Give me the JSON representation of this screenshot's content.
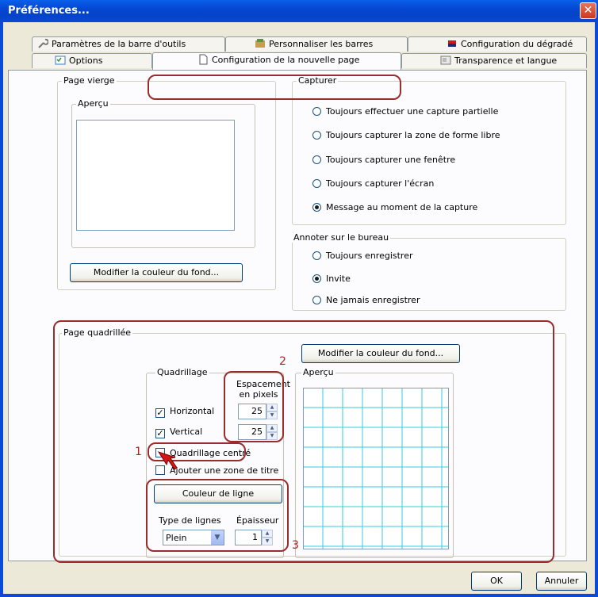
{
  "window": {
    "title": "Préférences..."
  },
  "tabs": {
    "row1": [
      {
        "label": "Paramètres de la barre d'outils",
        "icon": "wrench-icon"
      },
      {
        "label": "Personnaliser les barres",
        "icon": "toolbar-icon"
      },
      {
        "label": "Configuration du dégradé",
        "icon": "gradient-icon"
      }
    ],
    "row2": [
      {
        "label": "Options",
        "icon": "options-icon"
      },
      {
        "label": "Configuration de la nouvelle page",
        "icon": "page-icon",
        "active": true
      },
      {
        "label": "Transparence et langue",
        "icon": "transparency-icon"
      }
    ]
  },
  "blank_page": {
    "title": "Page vierge",
    "preview_title": "Aperçu",
    "bg_button": "Modifier la couleur du fond..."
  },
  "capture": {
    "title": "Capturer",
    "options": [
      {
        "label": "Toujours effectuer une capture partielle",
        "selected": false
      },
      {
        "label": "Toujours capturer la zone de forme libre",
        "selected": false
      },
      {
        "label": "Toujours capturer une fenêtre",
        "selected": false
      },
      {
        "label": "Toujours capturer l'écran",
        "selected": false
      },
      {
        "label": "Message au moment de la capture",
        "selected": true
      }
    ]
  },
  "desktop": {
    "title": "Annoter sur le bureau",
    "options": [
      {
        "label": "Toujours enregistrer",
        "selected": false
      },
      {
        "label": "Invite",
        "selected": true
      },
      {
        "label": "Ne jamais enregistrer",
        "selected": false
      }
    ]
  },
  "grid_page": {
    "title": "Page quadrillée",
    "bg_button": "Modifier la couleur du fond...",
    "grid_group": "Quadrillage",
    "spacing_label_1": "Espacement",
    "spacing_label_2": "en pixels",
    "horizontal": {
      "label": "Horizontal",
      "checked": true,
      "value": "25"
    },
    "vertical": {
      "label": "Vertical",
      "checked": true,
      "value": "25"
    },
    "centered": {
      "label": "Quadrillage centré",
      "checked": false
    },
    "title_zone": {
      "label": "Ajouter une zone de titre",
      "checked": false
    },
    "line_color_button": "Couleur de ligne",
    "line_type_label": "Type de lignes",
    "line_type_value": "Plein",
    "thickness_label": "Épaisseur",
    "thickness_value": "1",
    "preview_title": "Aperçu",
    "grid_line_color": "#33ccdd"
  },
  "annotations": {
    "n1": "1",
    "n2": "2",
    "n3": "3",
    "color": "#9b2c2c"
  },
  "footer": {
    "ok": "OK",
    "cancel": "Annuler"
  }
}
